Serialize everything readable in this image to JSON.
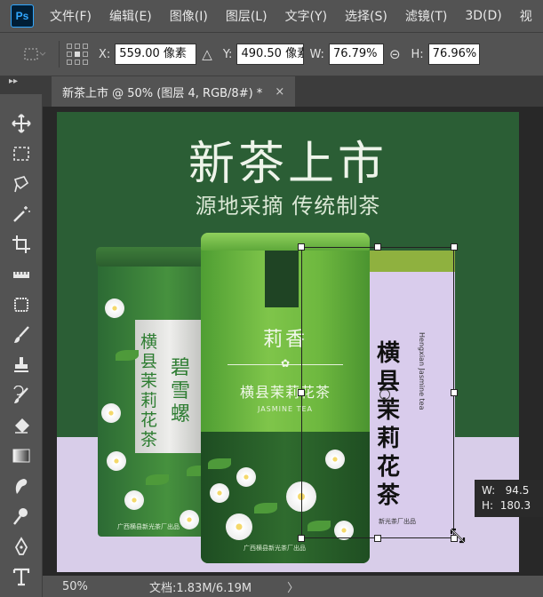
{
  "app": {
    "logo": "Ps"
  },
  "menu": [
    "文件(F)",
    "编辑(E)",
    "图像(I)",
    "图层(L)",
    "文字(Y)",
    "选择(S)",
    "滤镜(T)",
    "3D(D)",
    "视"
  ],
  "options": {
    "x_label": "X:",
    "x_value": "559.00 像素",
    "y_label": "Y:",
    "y_value": "490.50 像素",
    "w_label": "W:",
    "w_value": "76.79%",
    "h_label": "H:",
    "h_value": "76.96%",
    "delta_glyph": "△",
    "link_glyph": "⊝"
  },
  "panel_collapse": "▸▸",
  "document_tab": {
    "title": "新茶上市 @ 50% (图层 4, RGB/8#) *",
    "close": "×"
  },
  "canvas": {
    "headline": "新茶上市",
    "subline": "源地采摘 传统制茶",
    "tin_left": {
      "text1": "横县茉莉花茶",
      "text2": "碧雪螺",
      "bottom": "广西横县新光茶厂出品"
    },
    "tin_mid": {
      "title": "莉香",
      "name": "横县茉莉花茶",
      "english": "JASMINE TEA",
      "foot": "广西横县新光茶厂出品"
    },
    "tin_right": {
      "bigtext": "横县茉莉花茶",
      "vertical": "Hengxian Jasmine tea",
      "foot": "新光茶厂出品"
    },
    "colors": {
      "bg_green": "#2b5e35",
      "lavender": "#d8cde9",
      "tin_green": "#6eb83f"
    }
  },
  "tooltip": {
    "w_label": "W:",
    "w_value": "94.5",
    "h_label": "H:",
    "h_value": "180.3"
  },
  "status": {
    "zoom": "50%",
    "doc": "文档:1.83M/6.19M",
    "chevron": "〉"
  },
  "tools": [
    "move-tool-icon",
    "marquee-tool-icon",
    "lasso-tool-icon",
    "magic-wand-icon",
    "crop-tool-icon",
    "ruler-icon",
    "patch-tool-icon",
    "brush-tool-icon",
    "stamp-tool-icon",
    "history-brush-icon",
    "eraser-icon",
    "gradient-icon",
    "smudge-icon",
    "dodge-icon",
    "pen-tool-icon",
    "type-tool-icon"
  ]
}
